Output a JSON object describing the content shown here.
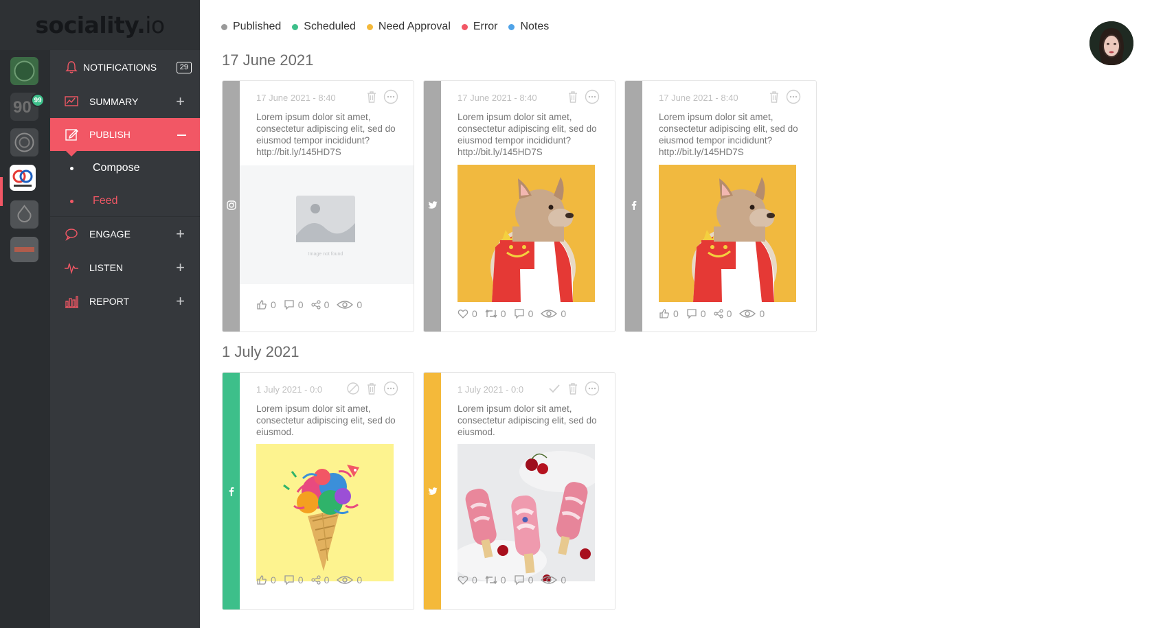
{
  "brand": {
    "name_main": "sociality.",
    "name_suffix": "io"
  },
  "accounts": {
    "badge": "99"
  },
  "menu": {
    "notifications": {
      "label": "NOTIFICATIONS",
      "count": "29"
    },
    "summary": {
      "label": "SUMMARY"
    },
    "publish": {
      "label": "PUBLISH"
    },
    "compose": {
      "label": "Compose"
    },
    "feed": {
      "label": "Feed"
    },
    "engage": {
      "label": "ENGAGE"
    },
    "listen": {
      "label": "LISTEN"
    },
    "report": {
      "label": "REPORT"
    }
  },
  "legend": [
    {
      "label": "Published",
      "color": "#9a9a9a"
    },
    {
      "label": "Scheduled",
      "color": "#3dbf8a"
    },
    {
      "label": "Need Approval",
      "color": "#f4b93a"
    },
    {
      "label": "Error",
      "color": "#f25765"
    },
    {
      "label": "Notes",
      "color": "#4fa3e8"
    }
  ],
  "groups": [
    {
      "date": "17 June 2021",
      "cards": [
        {
          "network": "instagram-icon",
          "status_color": "#a9a9a9",
          "time": "17 June 2021 - 8:40",
          "text": "Lorem ipsum dolor sit amet, consectetur adipiscing elit, sed do eiusmod tempor incididunt? http://bit.ly/145HD7S",
          "image": "not-found",
          "image_caption": "Image not found",
          "stats": {
            "likes": "0",
            "comments": "0",
            "shares": "0",
            "views": "0"
          }
        },
        {
          "network": "twitter-icon",
          "status_color": "#a9a9a9",
          "time": "17 June 2021 - 8:40",
          "text": "Lorem ipsum dolor sit amet, consectetur adipiscing elit, sed do eiusmod tempor incididunt? http://bit.ly/145HD7S",
          "image": "dog",
          "stats": {
            "likes": "0",
            "retweets": "0",
            "comments": "0",
            "views": "0"
          }
        },
        {
          "network": "facebook-icon",
          "status_color": "#a9a9a9",
          "time": "17 June 2021 - 8:40",
          "text": "Lorem ipsum dolor sit amet, consectetur adipiscing elit, sed do eiusmod tempor incididunt? http://bit.ly/145HD7S",
          "image": "dog",
          "stats": {
            "likes": "0",
            "comments": "0",
            "shares": "0",
            "views": "0"
          }
        }
      ]
    },
    {
      "date": "1 July 2021",
      "cards": [
        {
          "network": "facebook-icon",
          "status_color": "#3dbf8a",
          "time": "1 July 2021 - 0:0",
          "text": "Lorem ipsum dolor sit amet, consectetur adipiscing elit, sed do eiusmod.",
          "image": "confetti-cone",
          "stats": {
            "likes": "0",
            "comments": "0",
            "shares": "0",
            "views": "0"
          }
        },
        {
          "network": "twitter-icon",
          "status_color": "#f4b93a",
          "time": "1 July 2021 - 0:0",
          "text": "Lorem ipsum dolor sit amet, consectetur adipiscing elit, sed do eiusmod.",
          "image": "popsicles",
          "stats": {
            "likes": "0",
            "retweets": "0",
            "comments": "0",
            "views": "0"
          }
        }
      ]
    }
  ]
}
